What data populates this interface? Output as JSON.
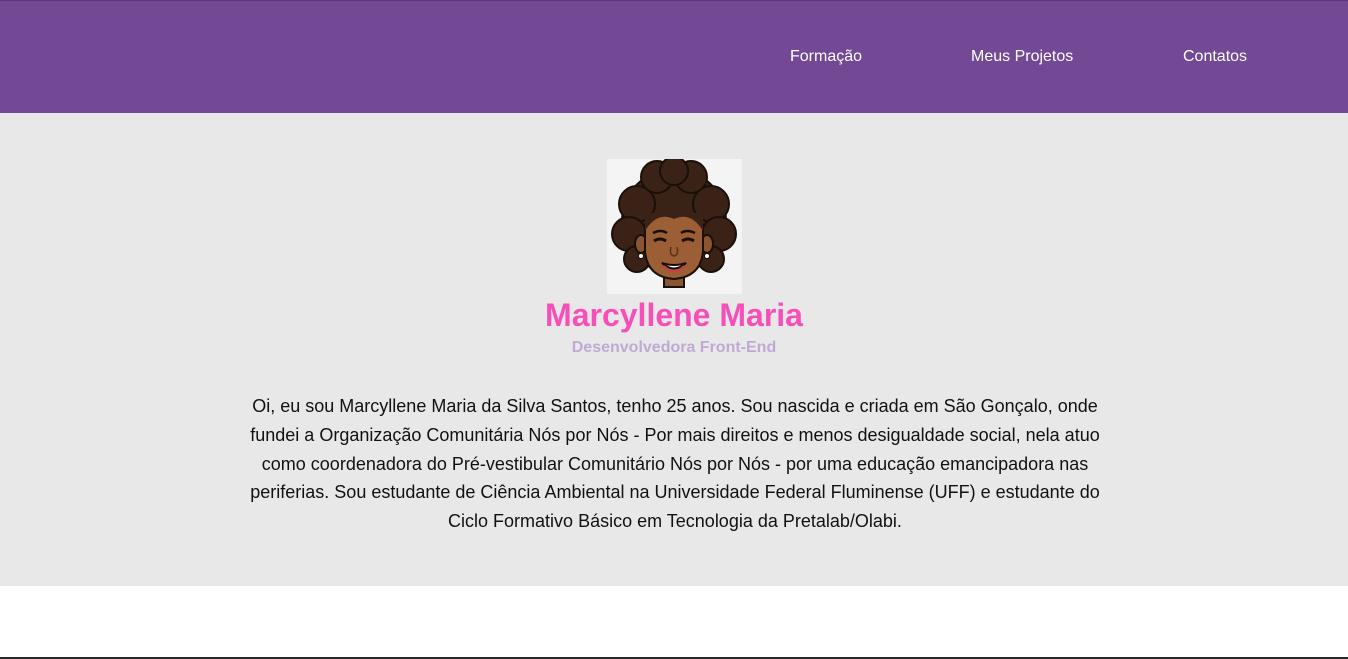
{
  "nav": {
    "items": [
      {
        "label": "Formação"
      },
      {
        "label": "Meus Projetos"
      },
      {
        "label": "Contatos"
      }
    ]
  },
  "profile": {
    "name": "Marcyllene Maria",
    "role": "Desenvolvedora Front-End",
    "bio": "Oi, eu sou Marcyllene Maria da Silva Santos, tenho 25 anos. Sou nascida e criada em São Gonçalo, onde fundei a Organização Comunitária Nós por Nós - Por mais direitos e menos desigualdade social, nela atuo como coordenadora do Pré-vestibular Comunitário Nós por Nós - por uma educação emancipadora nas periferias. Sou estudante de Ciência Ambiental na Universidade Federal Fluminense (UFF) e estudante do Ciclo Formativo Básico em Tecnologia da Pretalab/Olabi.",
    "avatar_icon": "avatar-illustration-icon"
  },
  "colors": {
    "header_bg": "#734895",
    "hero_bg": "#e9e8e9",
    "name_color": "#f74fb8",
    "role_color": "#bfaad6"
  }
}
